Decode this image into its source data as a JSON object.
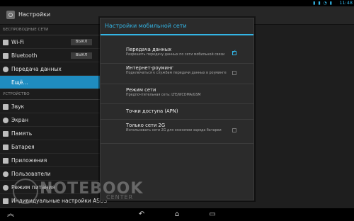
{
  "status_bar": {
    "time": "11:48",
    "icons": "▮ ▮ ◔ ▮"
  },
  "action_bar": {
    "title": "Настройки"
  },
  "sidebar": {
    "sections": [
      {
        "header": "Беспроводные сети",
        "items": [
          {
            "label": "Wi-Fi",
            "toggle": "ВЫКЛ",
            "icon": "wifi-icon"
          },
          {
            "label": "Bluetooth",
            "toggle": "ВЫКЛ",
            "icon": "bluetooth-icon"
          },
          {
            "label": "Передача данных",
            "icon": "data-usage-icon"
          },
          {
            "label": "Ещё...",
            "selected": true
          }
        ]
      },
      {
        "header": "Устройство",
        "items": [
          {
            "label": "Звук",
            "icon": "sound-icon"
          },
          {
            "label": "Экран",
            "icon": "display-icon"
          },
          {
            "label": "Память",
            "icon": "storage-icon"
          },
          {
            "label": "Батарея",
            "icon": "battery-icon"
          },
          {
            "label": "Приложения",
            "icon": "apps-icon"
          },
          {
            "label": "Пользователи",
            "icon": "users-icon"
          },
          {
            "label": "Режим питания",
            "icon": "power-icon"
          },
          {
            "label": "Индивидуальные настройки ASUS",
            "icon": "asus-settings-icon"
          }
        ]
      }
    ]
  },
  "dialog": {
    "title": "Настройки мобильной сети",
    "items": [
      {
        "title": "Передача данных",
        "summary": "Разрешить передачу данных по сети мобильной связи",
        "checkbox": true,
        "checked": true
      },
      {
        "title": "Интернет-роуминг",
        "summary": "Подключаться к службам передачи данных в роуминге",
        "checkbox": true,
        "checked": false
      },
      {
        "title": "Режим сети",
        "summary": "Предпочтительная сеть: LTE/WCDMA/GSM",
        "checkbox": false
      },
      {
        "title": "Точки доступа (APN)",
        "summary": "",
        "checkbox": false
      },
      {
        "title": "Только сети 2G",
        "summary": "Использовать сети 2G для экономии заряда батареи",
        "checkbox": true,
        "checked": false
      }
    ]
  },
  "nav_bar": {
    "back": "↶",
    "home": "⌂",
    "recents": "▭",
    "menu": "︽"
  },
  "watermark": {
    "main": "NOTEBOOK",
    "sub": "CENTER"
  },
  "colors": {
    "accent": "#33b5e5",
    "selected": "#1f8cc0"
  }
}
